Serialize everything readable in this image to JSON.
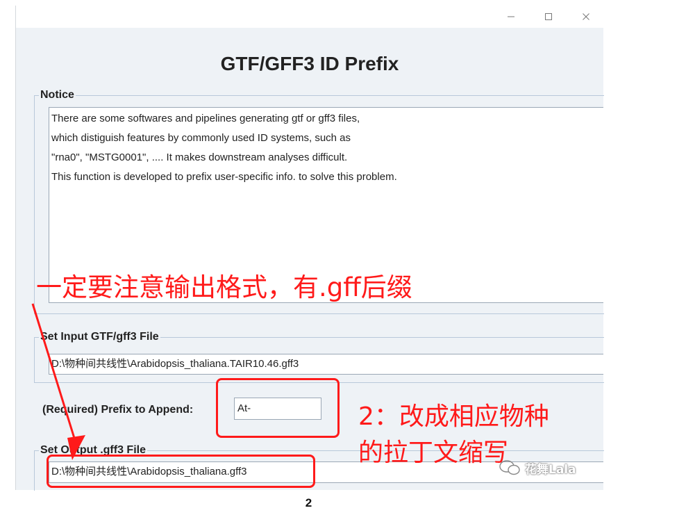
{
  "window": {
    "title": "GTF/GFF3 ID Prefix",
    "controls": {
      "minimize": "minimize-icon",
      "maximize": "maximize-icon",
      "close": "close-icon"
    }
  },
  "notice": {
    "title": "Notice",
    "lines": [
      "There are some softwares and pipelines generating gtf or gff3 files,",
      "which distiguish features by commonly used ID systems, such as",
      "\"rna0\", \"MSTG0001\", .... It makes downstream analyses difficult.",
      "This function is developed to prefix user-specific info. to solve this problem."
    ]
  },
  "input_file": {
    "title": "Set Input GTF/gff3 File",
    "value": "D:\\物种间共线性\\Arabidopsis_thaliana.TAIR10.46.gff3"
  },
  "prefix": {
    "label": "(Required) Prefix to Append:",
    "value": "At-"
  },
  "output_file": {
    "title": "Set Output .gff3 File",
    "value": "D:\\物种间共线性\\Arabidopsis_thaliana.gff3"
  },
  "annotations": {
    "note1": "一定要注意输出格式，有.gff后缀",
    "note2_line1": "2：改成相应物种",
    "note2_line2": "的拉丁文缩写",
    "color": "#ff1a1a"
  },
  "watermark": "花舞Lala",
  "caption": "2"
}
